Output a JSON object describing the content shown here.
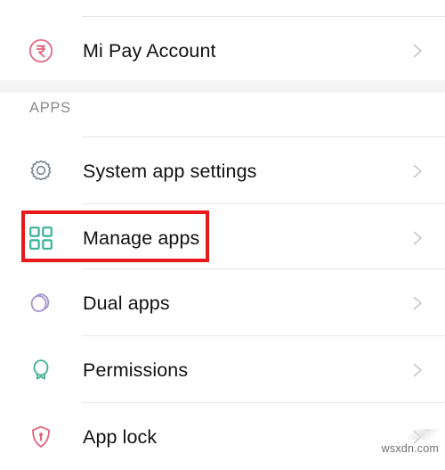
{
  "screen": {
    "title": "Settings - Apps",
    "background": "#ffffff"
  },
  "top_section": {
    "rows": [
      {
        "id": "mi-pay-account",
        "label": "Mi Pay Account",
        "icon": "rupee-circle-icon",
        "icon_color": "#e0617f",
        "chevron": "chevron-right-icon"
      }
    ]
  },
  "apps_section": {
    "header": "APPS",
    "header_color": "#8a8a8e",
    "band_color": "#f4f4f5",
    "rows": [
      {
        "id": "system-app-settings",
        "label": "System app settings",
        "icon": "gear-icon",
        "icon_color": "#7d8a96",
        "chevron": "chevron-right-icon"
      },
      {
        "id": "manage-apps",
        "label": "Manage apps",
        "icon": "grid-apps-icon",
        "icon_color": "#39b39a",
        "chevron": "chevron-right-icon",
        "highlighted": true
      },
      {
        "id": "dual-apps",
        "label": "Dual apps",
        "icon": "dual-circles-icon",
        "icon_color": "#a294d1",
        "chevron": "chevron-right-icon"
      },
      {
        "id": "permissions",
        "label": "Permissions",
        "icon": "badge-award-icon",
        "icon_color": "#3fae92",
        "chevron": "chevron-right-icon"
      },
      {
        "id": "app-lock",
        "label": "App lock",
        "icon": "shield-lock-icon",
        "icon_color": "#e0647f",
        "chevron": "chevron-right-icon"
      }
    ]
  },
  "annotation": {
    "type": "highlight-rectangle",
    "target": "manage-apps",
    "color": "#e8191b",
    "border_width": 4
  },
  "watermark": {
    "text": "wsxdn.com",
    "color": "#6f6f6f"
  },
  "colors": {
    "divider": "#e6e6e8",
    "text_primary": "#111111",
    "text_secondary": "#8a8a8e",
    "chevron": "#c8c8cc",
    "accent_red": "#e8191b"
  }
}
